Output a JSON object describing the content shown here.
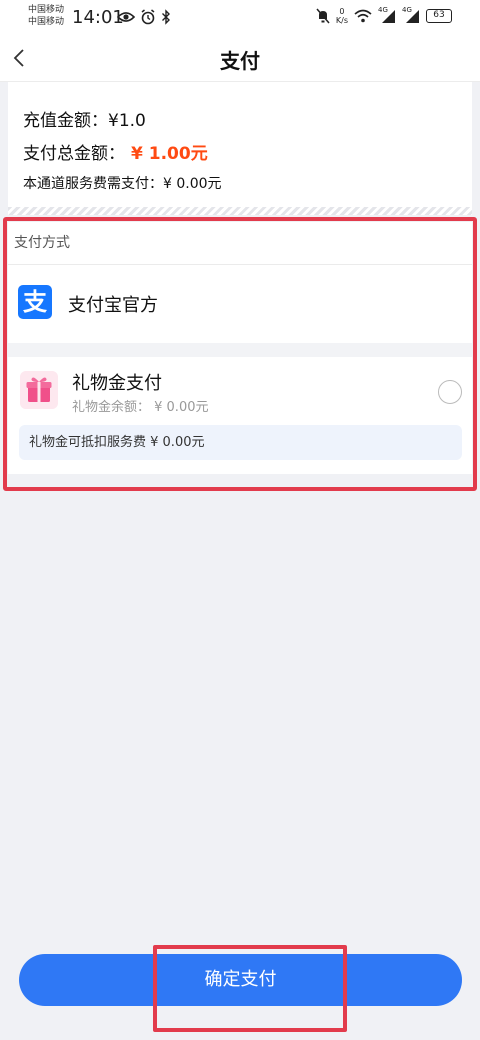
{
  "status_bar": {
    "carrier_1": "中国移动",
    "carrier_2": "中国移动",
    "time": "14:01",
    "net_speed_value": "0",
    "net_speed_unit": "K/s",
    "signal_1": "4G",
    "signal_2": "4G",
    "battery": "63"
  },
  "header": {
    "title": "支付",
    "back_icon": "chevron-left-icon"
  },
  "summary": {
    "recharge_label": "充值金额：",
    "recharge_value": "¥1.0",
    "total_label": "支付总金额：",
    "total_value": "¥ 1.00元",
    "fee_text": "本通道服务费需支付：¥ 0.00元"
  },
  "payment_methods": {
    "section_label": "支付方式",
    "alipay": {
      "icon": "alipay-icon",
      "icon_glyph": "支",
      "label": "支付宝官方"
    },
    "gift": {
      "icon": "gift-icon",
      "title": "礼物金支付",
      "balance": "礼物金余额：  ¥ 0.00元",
      "note": "礼物金可抵扣服务费 ¥ 0.00元",
      "selected": false
    }
  },
  "confirm_button": {
    "label": "确定支付"
  },
  "colors": {
    "accent_blue": "#2f78f5",
    "price_orange": "#ff4a12",
    "highlight_red": "#e23b4c",
    "background": "#f0f1f5"
  }
}
